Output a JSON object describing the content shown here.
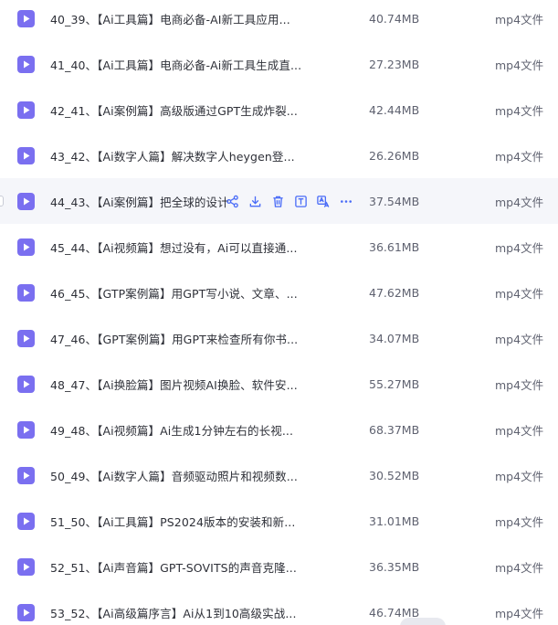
{
  "colors": {
    "accent": "#4a6cf7",
    "video_icon": "#7a6ff0",
    "hover_row": "#f5f6fa"
  },
  "files": [
    {
      "name": "40_39、【Ai工具篇】电商必备-AI新工具应用...",
      "size": "40.74MB",
      "type": "mp4文件",
      "icon": "video-file-icon"
    },
    {
      "name": "41_40、【Ai工具篇】电商必备-Ai新工具生成直...",
      "size": "27.23MB",
      "type": "mp4文件",
      "icon": "video-file-icon"
    },
    {
      "name": "42_41、【Ai案例篇】高级版通过GPT生成炸裂...",
      "size": "42.44MB",
      "type": "mp4文件",
      "icon": "video-file-icon"
    },
    {
      "name": "43_42、【Ai数字人篇】解决数字人heygen登...",
      "size": "26.26MB",
      "type": "mp4文件",
      "icon": "video-file-icon"
    },
    {
      "name": "44_43、【Ai案例篇】把全球的设计",
      "size": "37.54MB",
      "type": "mp4文件",
      "icon": "video-file-icon",
      "hovered": true
    },
    {
      "name": "45_44、【Ai视频篇】想过没有，Ai可以直接通...",
      "size": "36.61MB",
      "type": "mp4文件",
      "icon": "video-file-icon"
    },
    {
      "name": "46_45、【GTP案例篇】用GPT写小说、文章、...",
      "size": "47.62MB",
      "type": "mp4文件",
      "icon": "video-file-icon"
    },
    {
      "name": "47_46、【GPT案例篇】用GPT来检查所有你书...",
      "size": "34.07MB",
      "type": "mp4文件",
      "icon": "video-file-icon"
    },
    {
      "name": "48_47、【Ai换脸篇】图片视频AI换脸、软件安...",
      "size": "55.27MB",
      "type": "mp4文件",
      "icon": "video-file-icon"
    },
    {
      "name": "49_48、【Ai视频篇】Ai生成1分钟左右的长视...",
      "size": "68.37MB",
      "type": "mp4文件",
      "icon": "video-file-icon"
    },
    {
      "name": "50_49、【Ai数字人篇】音频驱动照片和视频数...",
      "size": "30.52MB",
      "type": "mp4文件",
      "icon": "video-file-icon"
    },
    {
      "name": "51_50、【Ai工具篇】PS2024版本的安装和新...",
      "size": "31.01MB",
      "type": "mp4文件",
      "icon": "video-file-icon"
    },
    {
      "name": "52_51、【Ai声音篇】GPT-SOVITS的声音克隆...",
      "size": "36.35MB",
      "type": "mp4文件",
      "icon": "video-file-icon"
    },
    {
      "name": "53_52、【Ai高级篇序言】Ai从1到10高级实战...",
      "size": "46.74MB",
      "type": "mp4文件",
      "icon": "video-file-icon"
    }
  ],
  "hover_actions": [
    {
      "icon": "share-icon"
    },
    {
      "icon": "download-icon"
    },
    {
      "icon": "delete-icon"
    },
    {
      "icon": "text-extract-icon"
    },
    {
      "icon": "ai-translate-icon"
    },
    {
      "icon": "more-icon"
    }
  ]
}
